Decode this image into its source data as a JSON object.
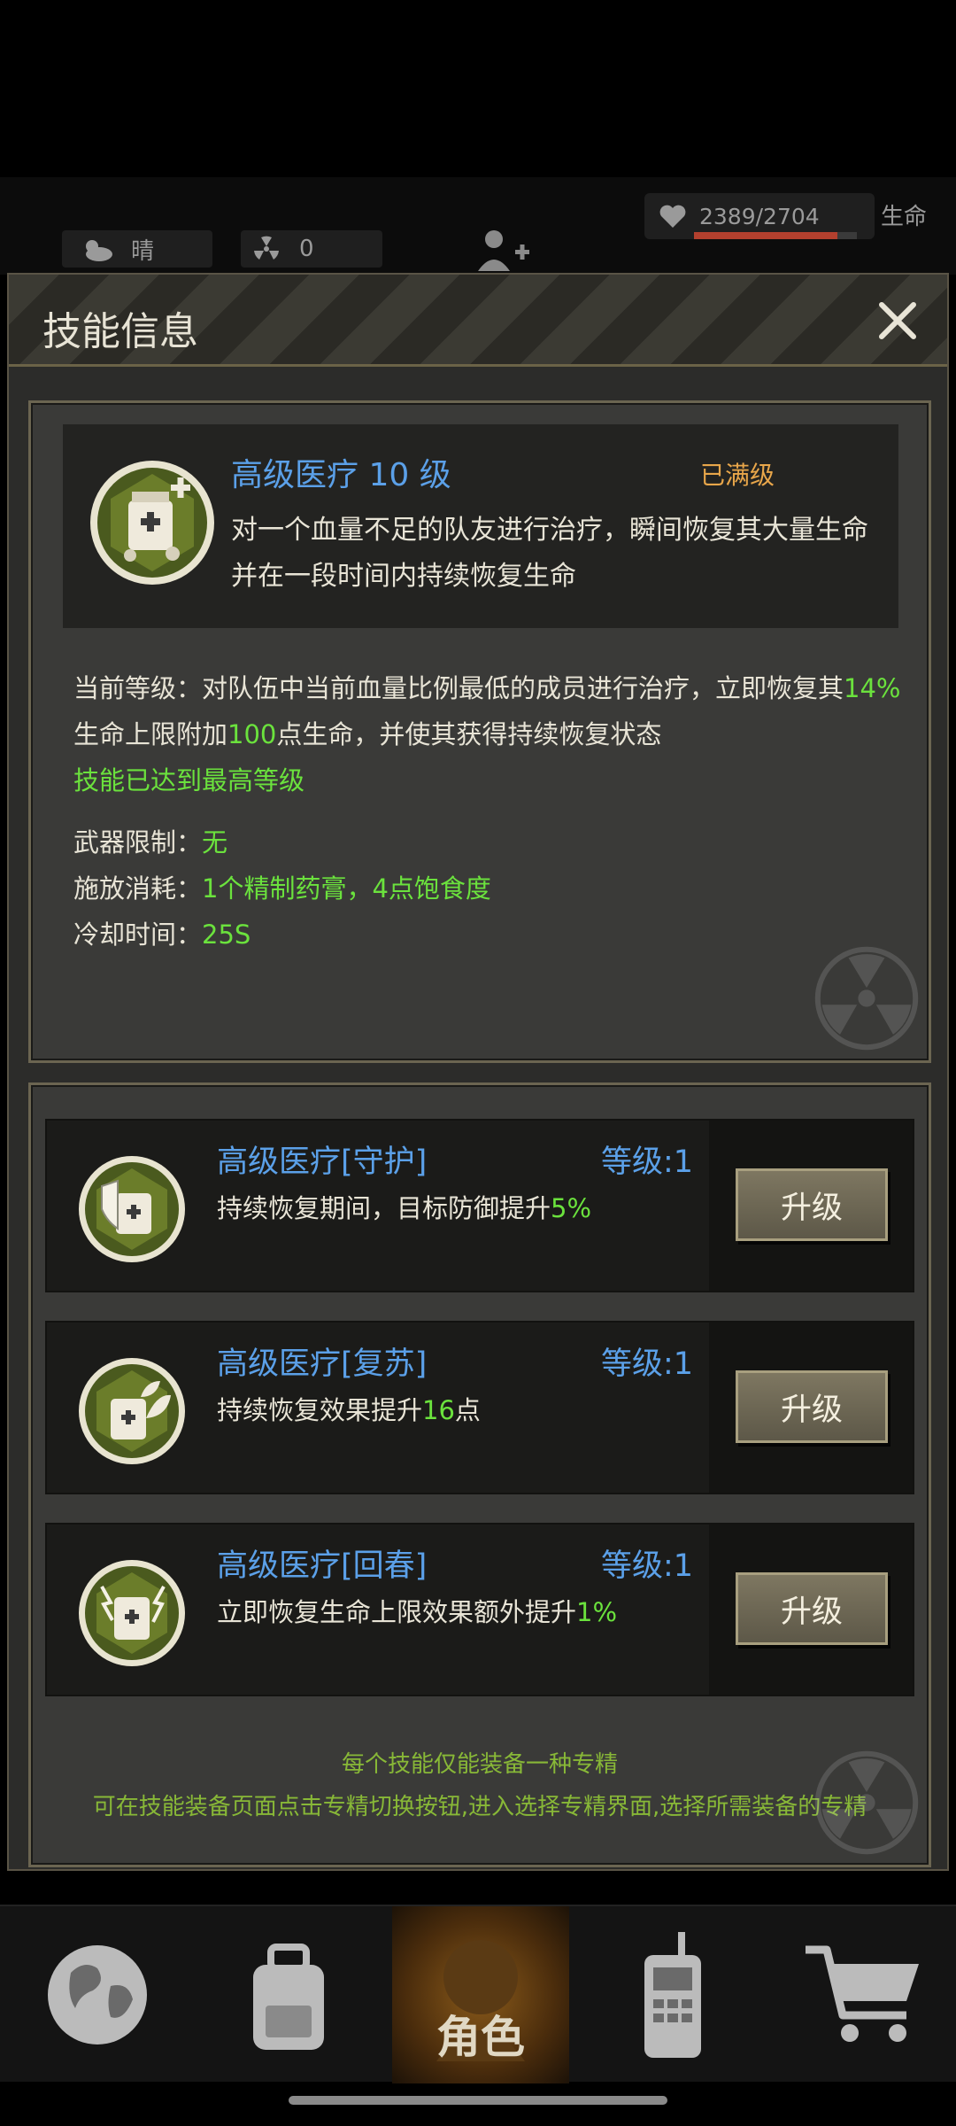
{
  "status_bar": {
    "weather": "晴",
    "radiation": "0",
    "hp_value": "2389/2704",
    "hp_fraction": 0.883,
    "hp_label": "生命",
    "colors": {
      "hp_fill": "#b3402e"
    }
  },
  "dialog": {
    "title": "技能信息",
    "skill": {
      "icon": "medkit-icon",
      "name": "高级医疗 10 级",
      "status": "已满级",
      "description": "对一个血量不足的队友进行治疗，瞬间恢复其大量生命并在一段时间内持续恢复生命"
    },
    "detail": {
      "line1_prefix": "当前等级：对队伍中当前血量比例最低的成员进行治疗，立即恢复其",
      "line1_value": "14%",
      "line2_prefix": "生命上限附加",
      "line2_value": "100",
      "line2_suffix": "点生命，并使其获得持续恢复状态",
      "max_level_note": "技能已达到最高等级",
      "weapon_label": "武器限制：",
      "weapon_value": "无",
      "cost_label": "施放消耗：",
      "cost_value": "1个精制药膏，4点饱食度",
      "cooldown_label": "冷却时间：",
      "cooldown_value": "25S"
    },
    "specializations": [
      {
        "icon": "medkit-shield-icon",
        "name": "高级医疗[守护]",
        "level": "等级:1",
        "desc_prefix": "持续恢复期间，目标防御提升",
        "desc_value": "5%",
        "desc_suffix": "",
        "button": "升级"
      },
      {
        "icon": "medkit-leaf-icon",
        "name": "高级医疗[复苏]",
        "level": "等级:1",
        "desc_prefix": "持续恢复效果提升",
        "desc_value": "16",
        "desc_suffix": "点",
        "button": "升级"
      },
      {
        "icon": "medkit-lightning-icon",
        "name": "高级医疗[回春]",
        "level": "等级:1",
        "desc_prefix": "立即恢复生命上限效果额外提升",
        "desc_value": "1%",
        "desc_suffix": "",
        "button": "升级"
      }
    ],
    "notes": [
      "每个技能仅能装备一种专精",
      "可在技能装备页面点击专精切换按钮,进入选择专精界面,选择所需装备的专精"
    ]
  },
  "nav": {
    "items": [
      {
        "icon": "globe-icon"
      },
      {
        "icon": "backpack-icon"
      },
      {
        "icon": "character-icon",
        "label": "角色",
        "active": true
      },
      {
        "icon": "radio-icon"
      },
      {
        "icon": "cart-icon"
      }
    ]
  }
}
